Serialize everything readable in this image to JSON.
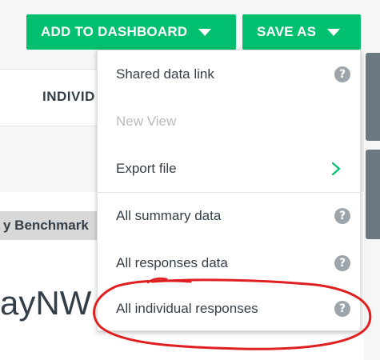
{
  "toolbar": {
    "add_to_dashboard": "ADD TO DASHBOARD",
    "save_as": "SAVE AS"
  },
  "background": {
    "individual_tab": "INDIVID",
    "benchmark_tag": "y Benchmark",
    "big_title": "ayNW to"
  },
  "menu": {
    "items": [
      {
        "label": "Shared data link",
        "icon": "help-icon",
        "enabled": true
      },
      {
        "label": "New View",
        "icon": "",
        "enabled": false
      },
      {
        "label": "Export file",
        "icon": "chevron-right-icon",
        "enabled": true
      },
      {
        "label": "All summary data",
        "icon": "help-icon",
        "enabled": true
      },
      {
        "label": "All responses data",
        "icon": "help-icon",
        "enabled": true
      },
      {
        "label": "All individual responses",
        "icon": "help-icon",
        "enabled": true
      }
    ],
    "help_glyph": "?"
  },
  "colors": {
    "accent": "#00bf6f",
    "annotation": "#e02020"
  }
}
